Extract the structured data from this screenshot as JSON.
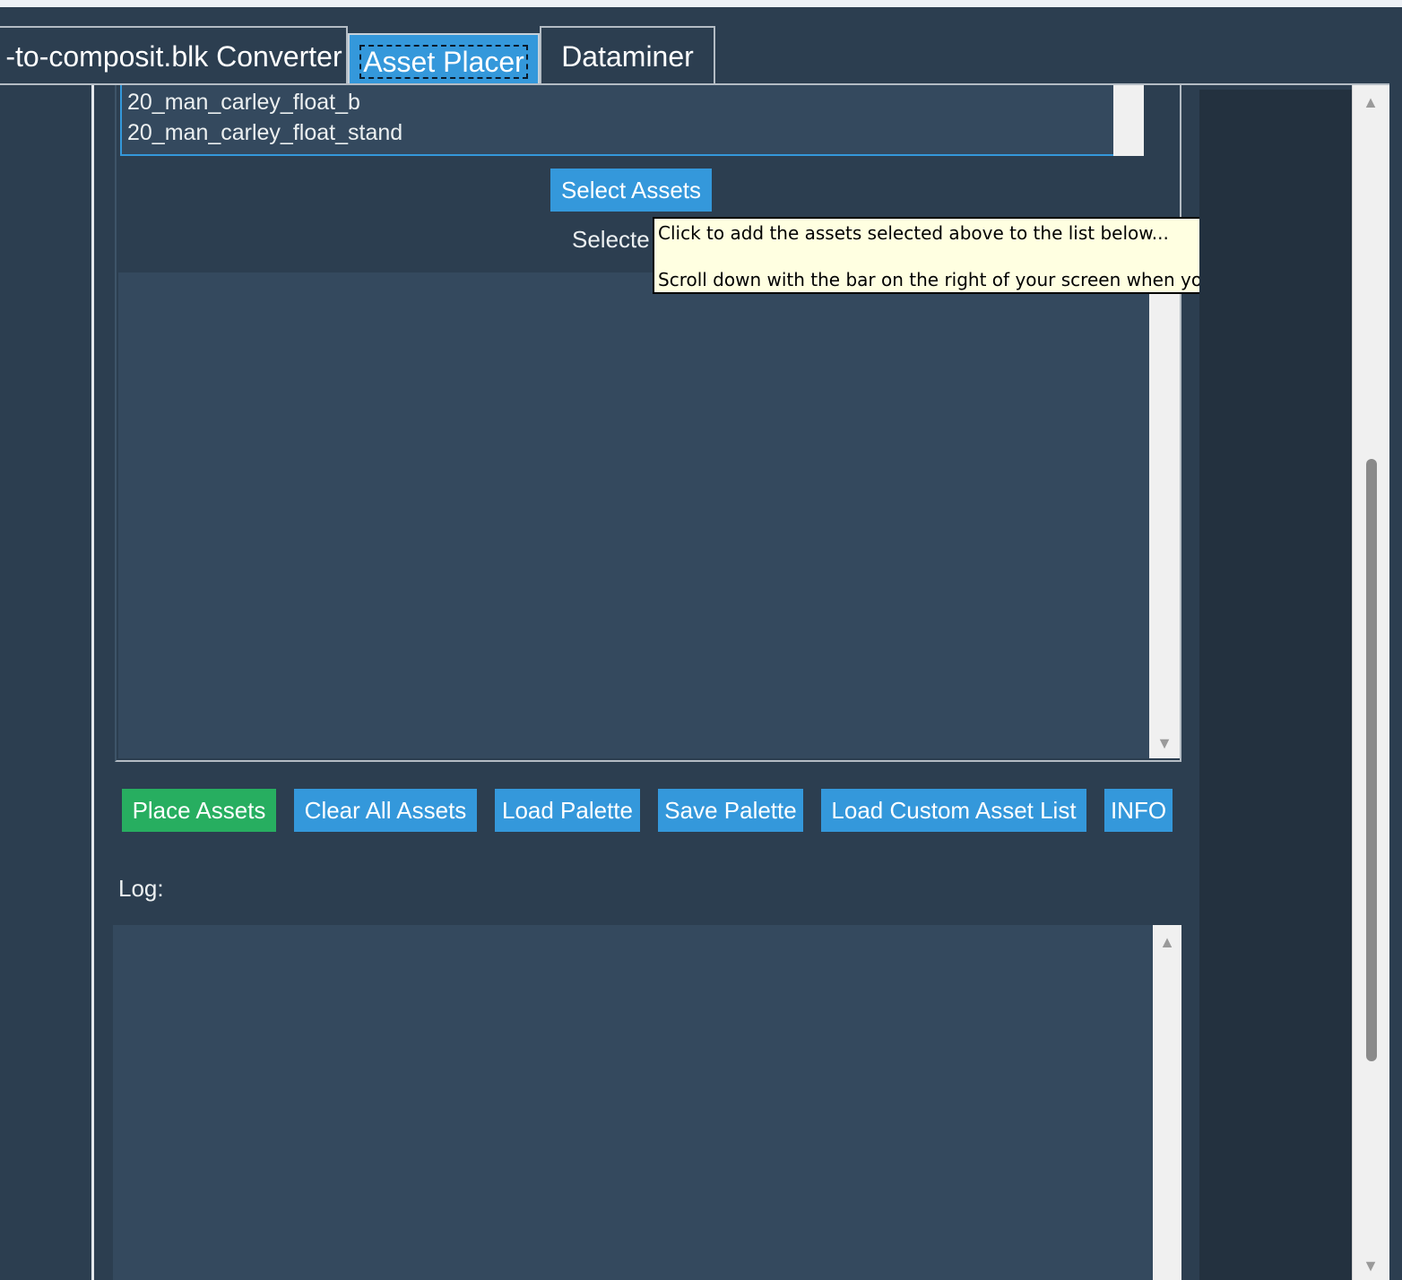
{
  "tabs": {
    "converter": "-to-composit.blk Converter",
    "asset_placer": "Asset Placer",
    "dataminer": "Dataminer"
  },
  "asset_list": {
    "items": [
      "20_man_carley_float_b",
      "20_man_carley_float_stand"
    ]
  },
  "select_assets_button": "Select Assets",
  "selected_label": "Selecte",
  "tooltip": {
    "line1": "Click to add the assets selected above to the list below...",
    "line2": "Scroll down with the bar on the right of your screen when you're done"
  },
  "actions": {
    "place_assets": "Place Assets",
    "clear_all_assets": "Clear All Assets",
    "load_palette": "Load Palette",
    "save_palette": "Save Palette",
    "load_custom_asset_list": "Load Custom Asset List",
    "info": "INFO"
  },
  "log": {
    "label": "Log:"
  },
  "icons": {
    "scroll_up": "▲",
    "scroll_down": "▼"
  },
  "colors": {
    "background": "#2c3e50",
    "accent": "#3498db",
    "place_button": "#27ae60",
    "tooltip_bg": "#ffffe1"
  }
}
